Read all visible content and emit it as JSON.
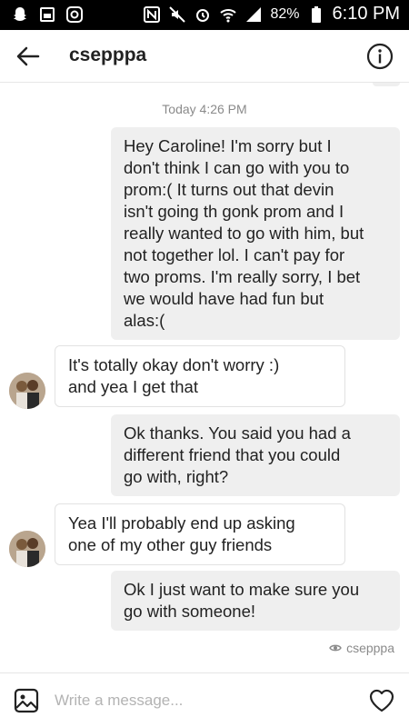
{
  "status_bar": {
    "battery": "82%",
    "time": "6:10 PM"
  },
  "header": {
    "title": "csepppa"
  },
  "thread": {
    "timestamp": "Today 4:26 PM",
    "messages": [
      {
        "direction": "outgoing",
        "text": "Hey Caroline! I'm sorry but I\ndon't think I can go with you to\nprom:( It turns out that devin\nisn't going th gonk prom and I\nreally wanted to go with him, but\nnot together lol. I can't pay for\ntwo proms. I'm really sorry, I bet\nwe would have had fun but\nalas:("
      },
      {
        "direction": "incoming",
        "text": "It's totally okay don't worry :)\nand yea I get that"
      },
      {
        "direction": "outgoing",
        "text": "Ok thanks. You said you had a\ndifferent friend that you could\ngo with, right?"
      },
      {
        "direction": "incoming",
        "text": "Yea I'll probably end up asking\none of my other guy friends"
      },
      {
        "direction": "outgoing",
        "text": "Ok I just want to make sure you\ngo with someone!"
      }
    ],
    "seen_by": "csepppa"
  },
  "composer": {
    "placeholder": "Write a message..."
  },
  "icons": {
    "back": "arrow-left-icon",
    "info": "info-icon",
    "gallery": "image-icon",
    "like": "heart-icon",
    "seen": "eye-icon"
  }
}
